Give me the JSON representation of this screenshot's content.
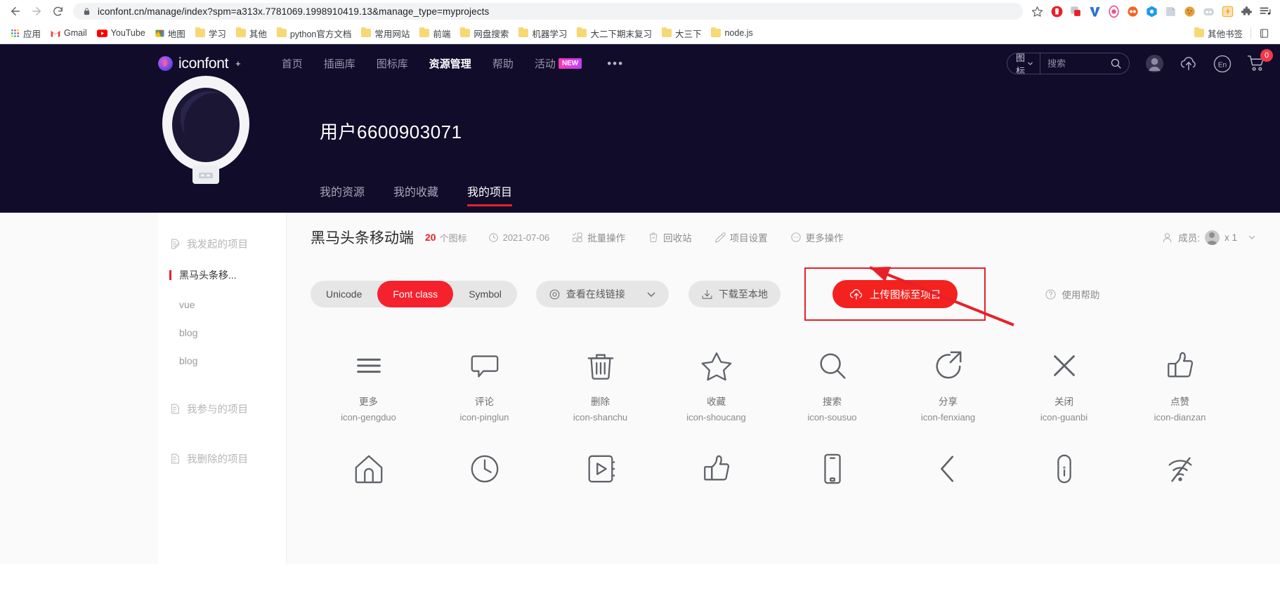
{
  "browser": {
    "url": "iconfont.cn/manage/index?spm=a313x.7781069.1998910419.13&manage_type=myprojects",
    "back_title": "后退",
    "forward_title": "前进",
    "reload_title": "重新加载",
    "bookmark_star_title": "收藏此标签页",
    "bookmarks": [
      {
        "label": "应用",
        "icon": "apps-grid-icon"
      },
      {
        "label": "Gmail",
        "icon": "gmail-icon"
      },
      {
        "label": "YouTube",
        "icon": "youtube-icon"
      },
      {
        "label": "地图",
        "icon": "google-maps-icon"
      },
      {
        "label": "学习",
        "icon": "folder-icon"
      },
      {
        "label": "其他",
        "icon": "folder-icon"
      },
      {
        "label": "python官方文档",
        "icon": "folder-icon"
      },
      {
        "label": "常用网站",
        "icon": "folder-icon"
      },
      {
        "label": "前端",
        "icon": "folder-icon"
      },
      {
        "label": "网盘搜索",
        "icon": "folder-icon"
      },
      {
        "label": "机器学习",
        "icon": "folder-icon"
      },
      {
        "label": "大二下期末复习",
        "icon": "folder-icon"
      },
      {
        "label": "大三下",
        "icon": "folder-icon"
      },
      {
        "label": "node.js",
        "icon": "folder-icon"
      }
    ],
    "other_bookmarks": {
      "label": "其他书签",
      "icon": "folder-icon"
    },
    "reading_list_icon": "reading-list-icon",
    "extensions": [
      {
        "name": "adblock-extension",
        "color": "#e8202a"
      },
      {
        "name": "screenshot-extension",
        "color": "#b9bec4"
      },
      {
        "name": "vimium-extension",
        "color": "#2a6fd6"
      },
      {
        "name": "tampermonkey-extension",
        "color": "#ef4b8a"
      },
      {
        "name": "infinity-extension",
        "color": "#f26322"
      },
      {
        "name": "evernote-extension",
        "color": "#1b9bf0"
      },
      {
        "name": "onenote-clipper-extension",
        "color": "#c8cdd3"
      },
      {
        "name": "cookie-editor-extension",
        "color": "#e2a23b"
      },
      {
        "name": "toby-extension",
        "color": "#cfd4d9"
      },
      {
        "name": "lightshot-extension",
        "color": "#f5a623"
      },
      {
        "name": "puzzle-extensions-menu",
        "color": "#5f6368"
      },
      {
        "name": "chrome-menu",
        "color": "#5f6368"
      }
    ]
  },
  "header": {
    "brand": "iconfont",
    "brand_superscript": "+",
    "nav": [
      {
        "label": "首页",
        "active": false
      },
      {
        "label": "插画库",
        "active": false
      },
      {
        "label": "图标库",
        "active": false
      },
      {
        "label": "资源管理",
        "active": true
      },
      {
        "label": "帮助",
        "active": false
      },
      {
        "label": "活动",
        "active": false,
        "badge": "NEW"
      }
    ],
    "more_dots": "•••",
    "search": {
      "type_label": "图标",
      "placeholder": "搜索",
      "value": ""
    },
    "icons": {
      "avatar": "user-avatar-icon",
      "upload": "cloud-upload-icon",
      "language": "En",
      "cart": "shopping-cart-icon",
      "cart_count": "0"
    }
  },
  "profile": {
    "avatar": "astronaut-helmet-avatar",
    "name": "用户6600903071",
    "tabs": [
      {
        "label": "我的资源",
        "active": false
      },
      {
        "label": "我的收藏",
        "active": false
      },
      {
        "label": "我的项目",
        "active": true
      }
    ]
  },
  "sidebar": {
    "groups": [
      {
        "label": "我发起的项目",
        "icon": "project-edit-icon",
        "items": [
          {
            "label": "黑马头条移...",
            "active": true
          },
          {
            "label": "vue",
            "active": false
          },
          {
            "label": "blog",
            "active": false
          },
          {
            "label": "blog",
            "active": false
          }
        ]
      },
      {
        "label": "我参与的项目",
        "icon": "project-join-icon",
        "items": []
      },
      {
        "label": "我删除的项目",
        "icon": "project-deleted-icon",
        "items": []
      }
    ]
  },
  "project": {
    "title": "黑马头条移动端",
    "icon_count": "20",
    "icon_count_unit": "个图标",
    "date": "2021-07-06",
    "date_icon": "clock-icon",
    "actions": [
      {
        "label": "批量操作",
        "icon": "batch-operation-icon"
      },
      {
        "label": "回收站",
        "icon": "recycle-bin-icon"
      },
      {
        "label": "项目设置",
        "icon": "pencil-settings-icon"
      },
      {
        "label": "更多操作",
        "icon": "more-ellipsis-icon"
      }
    ],
    "members": {
      "label": "成员:",
      "icon": "members-icon",
      "count": "x 1",
      "chevron": "chevron-down-icon"
    },
    "format_tabs": [
      {
        "label": "Unicode",
        "active": false
      },
      {
        "label": "Font class",
        "active": true
      },
      {
        "label": "Symbol",
        "active": false
      }
    ],
    "view_link": {
      "label": "查看在线链接",
      "icon": "eye-icon",
      "chevron": "chevron-down-icon"
    },
    "download": {
      "label": "下载至本地",
      "icon": "download-icon"
    },
    "upload": {
      "label": "上传图标至项目",
      "icon": "cloud-upload-icon"
    },
    "help": {
      "label": "使用帮助",
      "icon": "question-circle-icon"
    },
    "annotation": {
      "type": "red-arrow",
      "color": "#e8202a",
      "target": "上传图标至项目"
    }
  },
  "icons": [
    {
      "glyph": "hamburger-menu-icon",
      "label": "更多",
      "class": "icon-gengduo"
    },
    {
      "glyph": "comment-bubble-icon",
      "label": "评论",
      "class": "icon-pinglun"
    },
    {
      "glyph": "trash-bin-icon",
      "label": "删除",
      "class": "icon-shanchu"
    },
    {
      "glyph": "star-outline-icon",
      "label": "收藏",
      "class": "icon-shoucang"
    },
    {
      "glyph": "magnifier-icon",
      "label": "搜索",
      "class": "icon-sousuo"
    },
    {
      "glyph": "share-arrow-icon",
      "label": "分享",
      "class": "icon-fenxiang"
    },
    {
      "glyph": "close-x-icon",
      "label": "关闭",
      "class": "icon-guanbi"
    },
    {
      "glyph": "thumbs-up-icon",
      "label": "点赞",
      "class": "icon-dianzan"
    },
    {
      "glyph": "home-icon",
      "label": "",
      "class": ""
    },
    {
      "glyph": "clock-icon",
      "label": "",
      "class": ""
    },
    {
      "glyph": "video-play-icon",
      "label": "",
      "class": ""
    },
    {
      "glyph": "thumbs-up-icon",
      "label": "",
      "class": ""
    },
    {
      "glyph": "mobile-phone-icon",
      "label": "",
      "class": ""
    },
    {
      "glyph": "chevron-left-icon",
      "label": "",
      "class": ""
    },
    {
      "glyph": "lock-icon",
      "label": "",
      "class": ""
    },
    {
      "glyph": "wifi-off-icon",
      "label": "",
      "class": ""
    }
  ],
  "colors": {
    "brand_dark": "#100c2a",
    "accent_red": "#e8202a",
    "button_red": "#f4221f",
    "page_bg": "#fafafa"
  }
}
